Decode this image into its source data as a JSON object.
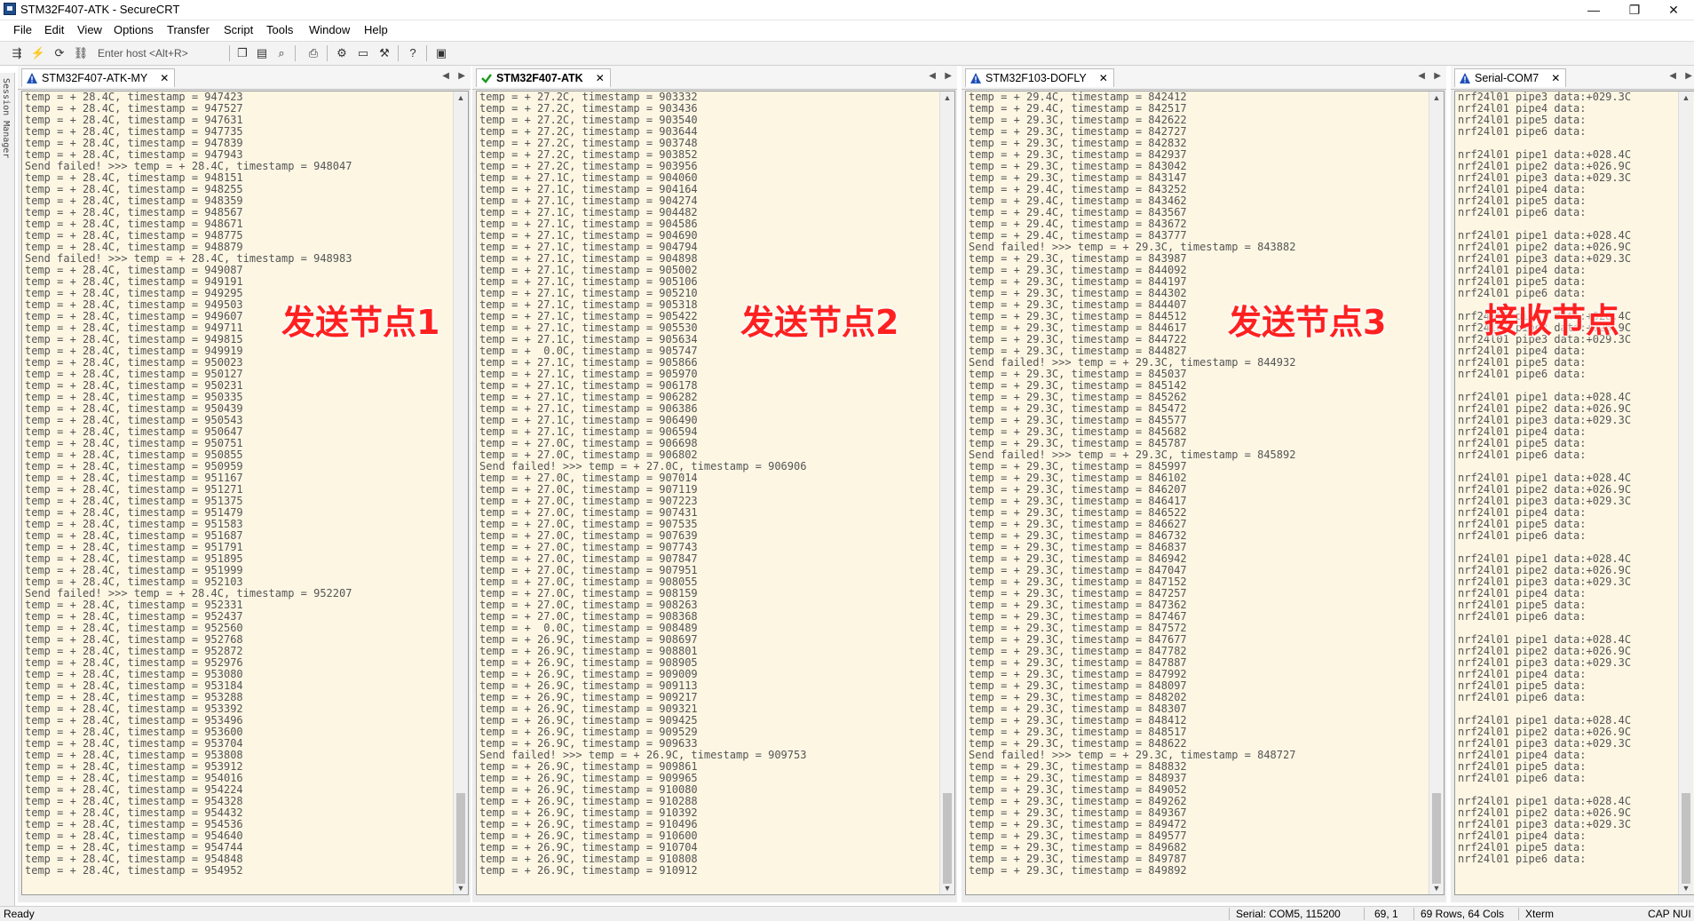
{
  "window": {
    "title": "STM32F407-ATK - SecureCRT",
    "min": "—",
    "restore": "❐",
    "close": "✕"
  },
  "menu": [
    "File",
    "Edit",
    "View",
    "Options",
    "Transfer",
    "Script",
    "Tools",
    "Window",
    "Help"
  ],
  "toolbar": {
    "host_placeholder": "Enter host <Alt+R>"
  },
  "session_manager": {
    "label": "Session Manager"
  },
  "colors": {
    "term_bg": "#fcf6e3",
    "overlay": "#ff2020",
    "active_check": "#1a9a1a",
    "warn_icon": "#1e4fb8"
  },
  "panes": [
    {
      "tab": "STM32F407-ATK-MY",
      "active": false,
      "overlay": "发送节点1",
      "lines": [
        "temp = + 28.4C, timestamp = 947423",
        "temp = + 28.4C, timestamp = 947527",
        "temp = + 28.4C, timestamp = 947631",
        "temp = + 28.4C, timestamp = 947735",
        "temp = + 28.4C, timestamp = 947839",
        "temp = + 28.4C, timestamp = 947943",
        "Send failed! >>> temp = + 28.4C, timestamp = 948047",
        "temp = + 28.4C, timestamp = 948151",
        "temp = + 28.4C, timestamp = 948255",
        "temp = + 28.4C, timestamp = 948359",
        "temp = + 28.4C, timestamp = 948567",
        "temp = + 28.4C, timestamp = 948671",
        "temp = + 28.4C, timestamp = 948775",
        "temp = + 28.4C, timestamp = 948879",
        "Send failed! >>> temp = + 28.4C, timestamp = 948983",
        "temp = + 28.4C, timestamp = 949087",
        "temp = + 28.4C, timestamp = 949191",
        "temp = + 28.4C, timestamp = 949295",
        "temp = + 28.4C, timestamp = 949503",
        "temp = + 28.4C, timestamp = 949607",
        "temp = + 28.4C, timestamp = 949711",
        "temp = + 28.4C, timestamp = 949815",
        "temp = + 28.4C, timestamp = 949919",
        "temp = + 28.4C, timestamp = 950023",
        "temp = + 28.4C, timestamp = 950127",
        "temp = + 28.4C, timestamp = 950231",
        "temp = + 28.4C, timestamp = 950335",
        "temp = + 28.4C, timestamp = 950439",
        "temp = + 28.4C, timestamp = 950543",
        "temp = + 28.4C, timestamp = 950647",
        "temp = + 28.4C, timestamp = 950751",
        "temp = + 28.4C, timestamp = 950855",
        "temp = + 28.4C, timestamp = 950959",
        "temp = + 28.4C, timestamp = 951167",
        "temp = + 28.4C, timestamp = 951271",
        "temp = + 28.4C, timestamp = 951375",
        "temp = + 28.4C, timestamp = 951479",
        "temp = + 28.4C, timestamp = 951583",
        "temp = + 28.4C, timestamp = 951687",
        "temp = + 28.4C, timestamp = 951791",
        "temp = + 28.4C, timestamp = 951895",
        "temp = + 28.4C, timestamp = 951999",
        "temp = + 28.4C, timestamp = 952103",
        "Send failed! >>> temp = + 28.4C, timestamp = 952207",
        "temp = + 28.4C, timestamp = 952331",
        "temp = + 28.4C, timestamp = 952437",
        "temp = + 28.4C, timestamp = 952560",
        "temp = + 28.4C, timestamp = 952768",
        "temp = + 28.4C, timestamp = 952872",
        "temp = + 28.4C, timestamp = 952976",
        "temp = + 28.4C, timestamp = 953080",
        "temp = + 28.4C, timestamp = 953184",
        "temp = + 28.4C, timestamp = 953288",
        "temp = + 28.4C, timestamp = 953392",
        "temp = + 28.4C, timestamp = 953496",
        "temp = + 28.4C, timestamp = 953600",
        "temp = + 28.4C, timestamp = 953704",
        "temp = + 28.4C, timestamp = 953808",
        "temp = + 28.4C, timestamp = 953912",
        "temp = + 28.4C, timestamp = 954016",
        "temp = + 28.4C, timestamp = 954224",
        "temp = + 28.4C, timestamp = 954328",
        "temp = + 28.4C, timestamp = 954432",
        "temp = + 28.4C, timestamp = 954536",
        "temp = + 28.4C, timestamp = 954640",
        "temp = + 28.4C, timestamp = 954744",
        "temp = + 28.4C, timestamp = 954848",
        "temp = + 28.4C, timestamp = 954952"
      ]
    },
    {
      "tab": "STM32F407-ATK",
      "active": true,
      "overlay": "发送节点2",
      "lines": [
        "temp = + 27.2C, timestamp = 903332",
        "temp = + 27.2C, timestamp = 903436",
        "temp = + 27.2C, timestamp = 903540",
        "temp = + 27.2C, timestamp = 903644",
        "temp = + 27.2C, timestamp = 903748",
        "temp = + 27.2C, timestamp = 903852",
        "temp = + 27.2C, timestamp = 903956",
        "temp = + 27.1C, timestamp = 904060",
        "temp = + 27.1C, timestamp = 904164",
        "temp = + 27.1C, timestamp = 904274",
        "temp = + 27.1C, timestamp = 904482",
        "temp = + 27.1C, timestamp = 904586",
        "temp = + 27.1C, timestamp = 904690",
        "temp = + 27.1C, timestamp = 904794",
        "temp = + 27.1C, timestamp = 904898",
        "temp = + 27.1C, timestamp = 905002",
        "temp = + 27.1C, timestamp = 905106",
        "temp = + 27.1C, timestamp = 905210",
        "temp = + 27.1C, timestamp = 905318",
        "temp = + 27.1C, timestamp = 905422",
        "temp = + 27.1C, timestamp = 905530",
        "temp = + 27.1C, timestamp = 905634",
        "temp = +  0.0C, timestamp = 905747",
        "temp = + 27.1C, timestamp = 905866",
        "temp = + 27.1C, timestamp = 905970",
        "temp = + 27.1C, timestamp = 906178",
        "temp = + 27.1C, timestamp = 906282",
        "temp = + 27.1C, timestamp = 906386",
        "temp = + 27.1C, timestamp = 906490",
        "temp = + 27.1C, timestamp = 906594",
        "temp = + 27.0C, timestamp = 906698",
        "temp = + 27.0C, timestamp = 906802",
        "Send failed! >>> temp = + 27.0C, timestamp = 906906",
        "temp = + 27.0C, timestamp = 907014",
        "temp = + 27.0C, timestamp = 907119",
        "temp = + 27.0C, timestamp = 907223",
        "temp = + 27.0C, timestamp = 907431",
        "temp = + 27.0C, timestamp = 907535",
        "temp = + 27.0C, timestamp = 907639",
        "temp = + 27.0C, timestamp = 907743",
        "temp = + 27.0C, timestamp = 907847",
        "temp = + 27.0C, timestamp = 907951",
        "temp = + 27.0C, timestamp = 908055",
        "temp = + 27.0C, timestamp = 908159",
        "temp = + 27.0C, timestamp = 908263",
        "temp = + 27.0C, timestamp = 908368",
        "temp = +  0.0C, timestamp = 908489",
        "temp = + 26.9C, timestamp = 908697",
        "temp = + 26.9C, timestamp = 908801",
        "temp = + 26.9C, timestamp = 908905",
        "temp = + 26.9C, timestamp = 909009",
        "temp = + 26.9C, timestamp = 909113",
        "temp = + 26.9C, timestamp = 909217",
        "temp = + 26.9C, timestamp = 909321",
        "temp = + 26.9C, timestamp = 909425",
        "temp = + 26.9C, timestamp = 909529",
        "temp = + 26.9C, timestamp = 909633",
        "Send failed! >>> temp = + 26.9C, timestamp = 909753",
        "temp = + 26.9C, timestamp = 909861",
        "temp = + 26.9C, timestamp = 909965",
        "temp = + 26.9C, timestamp = 910080",
        "temp = + 26.9C, timestamp = 910288",
        "temp = + 26.9C, timestamp = 910392",
        "temp = + 26.9C, timestamp = 910496",
        "temp = + 26.9C, timestamp = 910600",
        "temp = + 26.9C, timestamp = 910704",
        "temp = + 26.9C, timestamp = 910808",
        "temp = + 26.9C, timestamp = 910912"
      ]
    },
    {
      "tab": "STM32F103-DOFLY",
      "active": false,
      "overlay": "发送节点3",
      "lines": [
        "temp = + 29.4C, timestamp = 842412",
        "temp = + 29.4C, timestamp = 842517",
        "temp = + 29.3C, timestamp = 842622",
        "temp = + 29.3C, timestamp = 842727",
        "temp = + 29.3C, timestamp = 842832",
        "temp = + 29.3C, timestamp = 842937",
        "temp = + 29.3C, timestamp = 843042",
        "temp = + 29.3C, timestamp = 843147",
        "temp = + 29.4C, timestamp = 843252",
        "temp = + 29.4C, timestamp = 843462",
        "temp = + 29.4C, timestamp = 843567",
        "temp = + 29.4C, timestamp = 843672",
        "temp = + 29.4C, timestamp = 843777",
        "Send failed! >>> temp = + 29.3C, timestamp = 843882",
        "temp = + 29.3C, timestamp = 843987",
        "temp = + 29.3C, timestamp = 844092",
        "temp = + 29.3C, timestamp = 844197",
        "temp = + 29.3C, timestamp = 844302",
        "temp = + 29.3C, timestamp = 844407",
        "temp = + 29.3C, timestamp = 844512",
        "temp = + 29.3C, timestamp = 844617",
        "temp = + 29.3C, timestamp = 844722",
        "temp = + 29.3C, timestamp = 844827",
        "Send failed! >>> temp = + 29.3C, timestamp = 844932",
        "temp = + 29.3C, timestamp = 845037",
        "temp = + 29.3C, timestamp = 845142",
        "temp = + 29.3C, timestamp = 845262",
        "temp = + 29.3C, timestamp = 845472",
        "temp = + 29.3C, timestamp = 845577",
        "temp = + 29.3C, timestamp = 845682",
        "temp = + 29.3C, timestamp = 845787",
        "Send failed! >>> temp = + 29.3C, timestamp = 845892",
        "temp = + 29.3C, timestamp = 845997",
        "temp = + 29.3C, timestamp = 846102",
        "temp = + 29.3C, timestamp = 846207",
        "temp = + 29.3C, timestamp = 846417",
        "temp = + 29.3C, timestamp = 846522",
        "temp = + 29.3C, timestamp = 846627",
        "temp = + 29.3C, timestamp = 846732",
        "temp = + 29.3C, timestamp = 846837",
        "temp = + 29.3C, timestamp = 846942",
        "temp = + 29.3C, timestamp = 847047",
        "temp = + 29.3C, timestamp = 847152",
        "temp = + 29.3C, timestamp = 847257",
        "temp = + 29.3C, timestamp = 847362",
        "temp = + 29.3C, timestamp = 847467",
        "temp = + 29.3C, timestamp = 847572",
        "temp = + 29.3C, timestamp = 847677",
        "temp = + 29.3C, timestamp = 847782",
        "temp = + 29.3C, timestamp = 847887",
        "temp = + 29.3C, timestamp = 847992",
        "temp = + 29.3C, timestamp = 848097",
        "temp = + 29.3C, timestamp = 848202",
        "temp = + 29.3C, timestamp = 848307",
        "temp = + 29.3C, timestamp = 848412",
        "temp = + 29.3C, timestamp = 848517",
        "temp = + 29.3C, timestamp = 848622",
        "Send failed! >>> temp = + 29.3C, timestamp = 848727",
        "temp = + 29.3C, timestamp = 848832",
        "temp = + 29.3C, timestamp = 848937",
        "temp = + 29.3C, timestamp = 849052",
        "temp = + 29.3C, timestamp = 849262",
        "temp = + 29.3C, timestamp = 849367",
        "temp = + 29.3C, timestamp = 849472",
        "temp = + 29.3C, timestamp = 849577",
        "temp = + 29.3C, timestamp = 849682",
        "temp = + 29.3C, timestamp = 849787",
        "temp = + 29.3C, timestamp = 849892"
      ]
    },
    {
      "tab": "Serial-COM7",
      "active": false,
      "overlay": "接收节点",
      "lines": [
        "nrf24l01 pipe3 data:+029.3C",
        "nrf24l01 pipe4 data:",
        "nrf24l01 pipe5 data:",
        "nrf24l01 pipe6 data:",
        "",
        "nrf24l01 pipe1 data:+028.4C",
        "nrf24l01 pipe2 data:+026.9C",
        "nrf24l01 pipe3 data:+029.3C",
        "nrf24l01 pipe4 data:",
        "nrf24l01 pipe5 data:",
        "nrf24l01 pipe6 data:",
        "",
        "nrf24l01 pipe1 data:+028.4C",
        "nrf24l01 pipe2 data:+026.9C",
        "nrf24l01 pipe3 data:+029.3C",
        "nrf24l01 pipe4 data:",
        "nrf24l01 pipe5 data:",
        "nrf24l01 pipe6 data:",
        "",
        "nrf24l01 pipe1 data:+028.4C",
        "nrf24l01 pipe2 data:+026.9C",
        "nrf24l01 pipe3 data:+029.3C",
        "nrf24l01 pipe4 data:",
        "nrf24l01 pipe5 data:",
        "nrf24l01 pipe6 data:",
        "",
        "nrf24l01 pipe1 data:+028.4C",
        "nrf24l01 pipe2 data:+026.9C",
        "nrf24l01 pipe3 data:+029.3C",
        "nrf24l01 pipe4 data:",
        "nrf24l01 pipe5 data:",
        "nrf24l01 pipe6 data:",
        "",
        "nrf24l01 pipe1 data:+028.4C",
        "nrf24l01 pipe2 data:+026.9C",
        "nrf24l01 pipe3 data:+029.3C",
        "nrf24l01 pipe4 data:",
        "nrf24l01 pipe5 data:",
        "nrf24l01 pipe6 data:",
        "",
        "nrf24l01 pipe1 data:+028.4C",
        "nrf24l01 pipe2 data:+026.9C",
        "nrf24l01 pipe3 data:+029.3C",
        "nrf24l01 pipe4 data:",
        "nrf24l01 pipe5 data:",
        "nrf24l01 pipe6 data:",
        "",
        "nrf24l01 pipe1 data:+028.4C",
        "nrf24l01 pipe2 data:+026.9C",
        "nrf24l01 pipe3 data:+029.3C",
        "nrf24l01 pipe4 data:",
        "nrf24l01 pipe5 data:",
        "nrf24l01 pipe6 data:",
        "",
        "nrf24l01 pipe1 data:+028.4C",
        "nrf24l01 pipe2 data:+026.9C",
        "nrf24l01 pipe3 data:+029.3C",
        "nrf24l01 pipe4 data:",
        "nrf24l01 pipe5 data:",
        "nrf24l01 pipe6 data:",
        "",
        "nrf24l01 pipe1 data:+028.4C",
        "nrf24l01 pipe2 data:+026.9C",
        "nrf24l01 pipe3 data:+029.3C",
        "nrf24l01 pipe4 data:",
        "nrf24l01 pipe5 data:",
        "nrf24l01 pipe6 data:"
      ]
    }
  ],
  "status": {
    "ready": "Ready",
    "serial": "Serial: COM5, 115200",
    "cursor": "69,  1",
    "size": "69 Rows, 64 Cols",
    "term": "Xterm",
    "cap": "CAP",
    "num": "NUI"
  }
}
